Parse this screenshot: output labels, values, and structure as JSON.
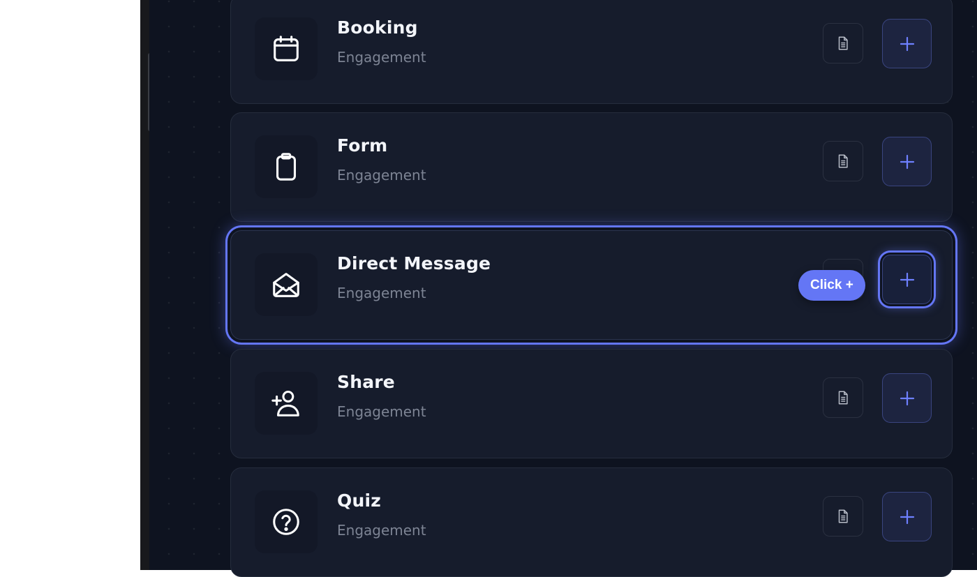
{
  "tooltip": {
    "text": "Click +"
  },
  "items": [
    {
      "title": "Booking",
      "subtitle": "Engagement",
      "icon": "calendar-icon"
    },
    {
      "title": "Form",
      "subtitle": "Engagement",
      "icon": "clipboard-icon"
    },
    {
      "title": "Direct Message",
      "subtitle": "Engagement",
      "icon": "envelope-open-icon",
      "highlighted": true
    },
    {
      "title": "Share",
      "subtitle": "Engagement",
      "icon": "add-user-icon"
    },
    {
      "title": "Quiz",
      "subtitle": "Engagement",
      "icon": "question-circle-icon"
    }
  ],
  "colors": {
    "accent": "#6476f5",
    "background": "#0e1320",
    "card": "#161c2c"
  }
}
